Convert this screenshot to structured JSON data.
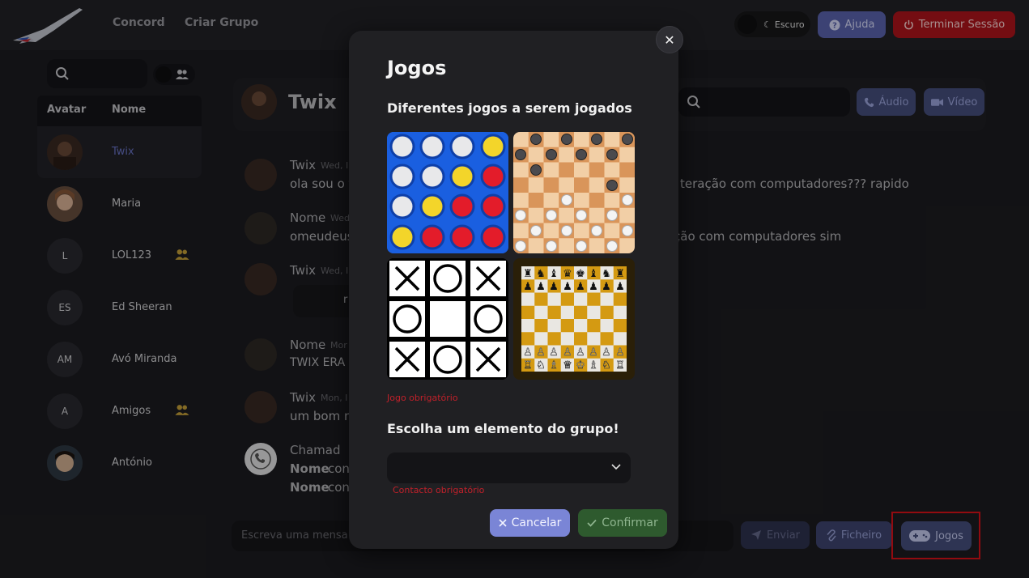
{
  "nav": {
    "links": [
      "Concord",
      "Criar Grupo"
    ],
    "theme_label": "Escuro",
    "help_label": "Ajuda",
    "logout_label": "Terminar Sessão"
  },
  "sidebar": {
    "col_avatar": "Avatar",
    "col_name": "Nome",
    "contacts": [
      {
        "initials": "",
        "name": "Twix",
        "group": false,
        "active": true
      },
      {
        "initials": "",
        "name": "Maria",
        "group": false
      },
      {
        "initials": "L",
        "name": "LOL123",
        "group": true
      },
      {
        "initials": "ES",
        "name": "Ed Sheeran",
        "group": false
      },
      {
        "initials": "AM",
        "name": "Avó Miranda",
        "group": false
      },
      {
        "initials": "A",
        "name": "Amigos",
        "group": true
      },
      {
        "initials": "",
        "name": "António",
        "group": false
      }
    ]
  },
  "chat": {
    "name": "Twix",
    "audio_label": "Áudio",
    "video_label": "Vídeo",
    "messages": [
      {
        "author": "Twix",
        "time": "Wed, I",
        "text": "ola sou o t",
        "tail": "teração com computadores??? rapido"
      },
      {
        "author": "Nome",
        "time": "Wed",
        "text": "omeudeus",
        "tail": "ção com computadores sim"
      },
      {
        "author": "Twix",
        "time": "Wed, I",
        "text": "r"
      },
      {
        "author": "Nome",
        "time": "Mor",
        "text": "TWIX ERA E"
      },
      {
        "author": "Twix",
        "time": "Mon, I",
        "text": "um bom n"
      },
      {
        "author": "Chamad",
        "time": "",
        "text": "con",
        "line2": "con",
        "bold": "Nome"
      }
    ],
    "composer_placeholder": "Escreva uma mensa",
    "send_label": "Enviar",
    "file_label": "Ficheiro",
    "games_label": "Jogos"
  },
  "modal": {
    "title": "Jogos",
    "subtitle": "Diferentes jogos a serem jogados",
    "games": [
      "connect-four",
      "checkers",
      "tic-tac-toe",
      "chess"
    ],
    "game_error": "Jogo obrigatório",
    "group_prompt": "Escolha um elemento do grupo!",
    "contact_error": "Contacto obrigatório",
    "cancel_label": "Cancelar",
    "confirm_label": "Confirmar",
    "close_symbol": "✕"
  },
  "colors": {
    "accent": "#5c66b3",
    "danger": "#b3151c",
    "confirm": "#2e5a2e",
    "error_text": "#c0202a",
    "highlight_box": "#e0121a"
  }
}
